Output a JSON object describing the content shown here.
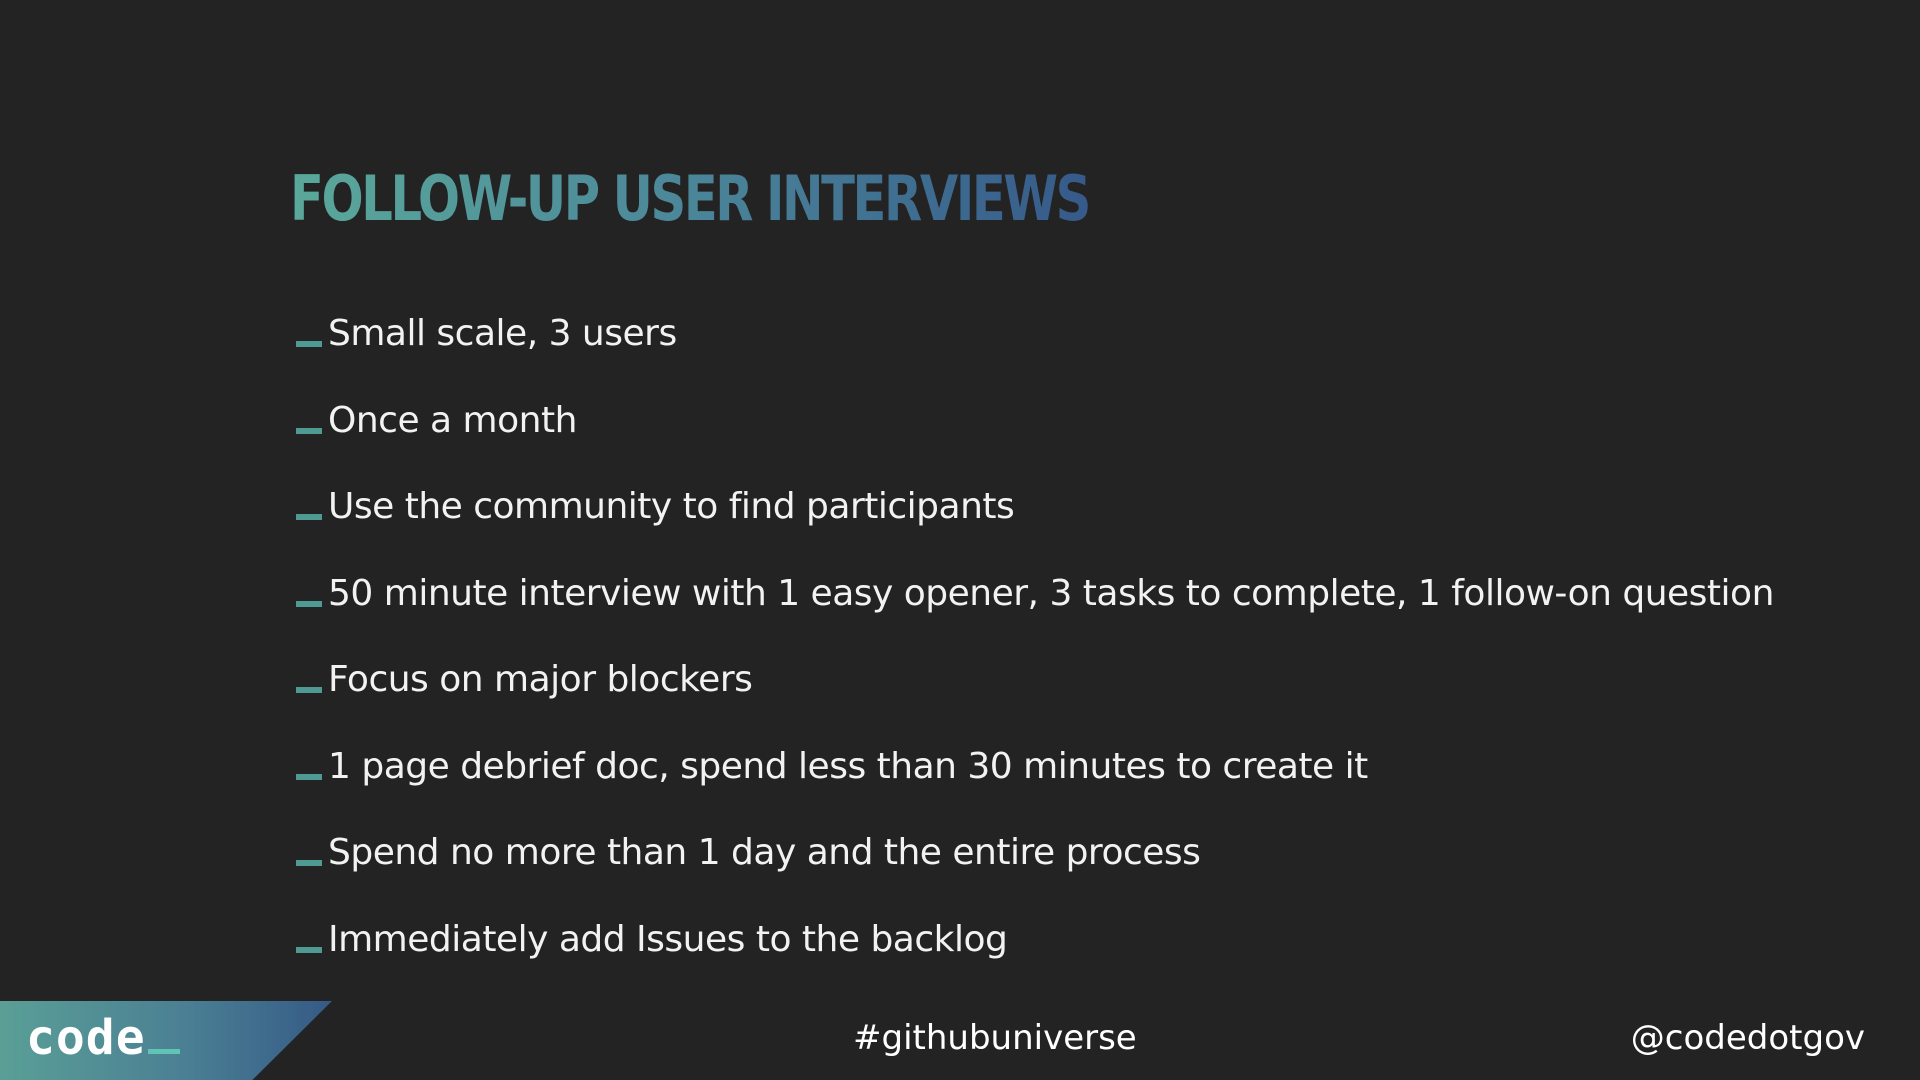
{
  "slide": {
    "title": "FOLLOW-UP USER INTERVIEWS",
    "bullets": [
      "Small scale, 3 users",
      "Once a month",
      "Use the community to find participants",
      "50 minute interview with 1 easy opener, 3 tasks to complete, 1 follow-on question",
      "Focus on major blockers",
      "1 page debrief doc, spend less than 30 minutes to create it",
      "Spend no more than 1 day and the entire process",
      "Immediately add Issues to the backlog"
    ]
  },
  "footer": {
    "logo_text": "code",
    "hashtag": "#githubuniverse",
    "handle": "@codedotgov"
  },
  "colors": {
    "background": "#232323",
    "title_gradient_start": "#5aa89a",
    "title_gradient_end": "#365a8a",
    "bullet_dash": "#4f9a92",
    "text": "#f2f2f2"
  },
  "icons": {
    "bullet": "dash-bullet-icon"
  }
}
